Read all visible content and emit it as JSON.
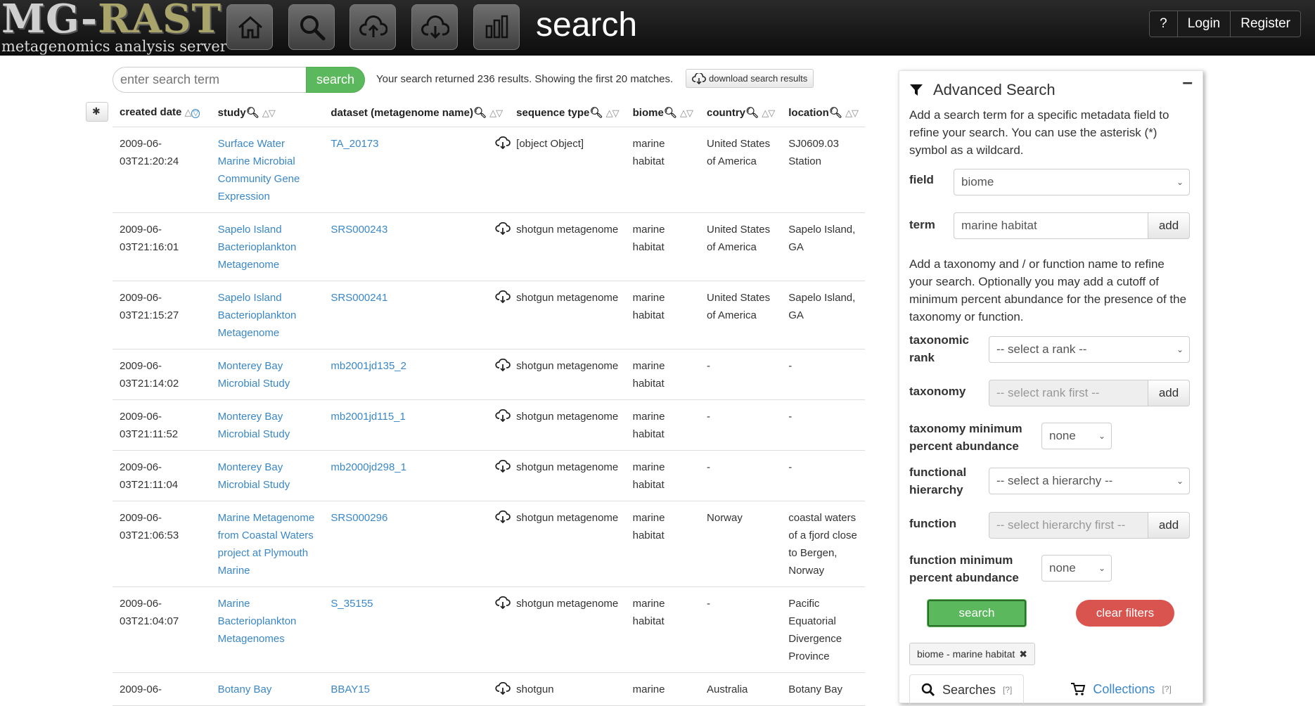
{
  "header": {
    "logo_main": "MG-",
    "logo_accent": "RAST",
    "logo_sub": "metagenomics analysis server",
    "page_title": "search",
    "help": "?",
    "login": "Login",
    "register": "Register",
    "nav_icons": [
      "home-icon",
      "search-icon",
      "upload-icon",
      "download-icon",
      "bar-chart-icon"
    ]
  },
  "search": {
    "placeholder": "enter search term",
    "button": "search",
    "result_text": "Your search returned 236 results. Showing the first 20 matches.",
    "download_label": "download search results"
  },
  "table": {
    "columns": [
      "created date",
      "study",
      "dataset (metagenome name)",
      "sequence type",
      "biome",
      "country",
      "location"
    ],
    "rows": [
      {
        "date": "2009-06-03T21:20:24",
        "study": "Surface Water Marine Microbial Community Gene Expression",
        "dataset": "TA_20173",
        "seq": "[object Object]",
        "biome": "marine habitat",
        "country": "United States of America",
        "location": "SJ0609.03 Station"
      },
      {
        "date": "2009-06-03T21:16:01",
        "study": "Sapelo Island Bacterioplankton Metagenome",
        "dataset": "SRS000243",
        "seq": "shotgun metagenome",
        "biome": "marine habitat",
        "country": "United States of America",
        "location": "Sapelo Island, GA"
      },
      {
        "date": "2009-06-03T21:15:27",
        "study": "Sapelo Island Bacterioplankton Metagenome",
        "dataset": "SRS000241",
        "seq": "shotgun metagenome",
        "biome": "marine habitat",
        "country": "United States of America",
        "location": "Sapelo Island, GA"
      },
      {
        "date": "2009-06-03T21:14:02",
        "study": "Monterey Bay Microbial Study",
        "dataset": "mb2001jd135_2",
        "seq": "shotgun metagenome",
        "biome": "marine habitat",
        "country": "-",
        "location": "-"
      },
      {
        "date": "2009-06-03T21:11:52",
        "study": "Monterey Bay Microbial Study",
        "dataset": "mb2001jd115_1",
        "seq": "shotgun metagenome",
        "biome": "marine habitat",
        "country": "-",
        "location": "-"
      },
      {
        "date": "2009-06-03T21:11:04",
        "study": "Monterey Bay Microbial Study",
        "dataset": "mb2000jd298_1",
        "seq": "shotgun metagenome",
        "biome": "marine habitat",
        "country": "-",
        "location": "-"
      },
      {
        "date": "2009-06-03T21:06:53",
        "study": "Marine Metagenome from Coastal Waters project at Plymouth Marine",
        "dataset": "SRS000296",
        "seq": "shotgun metagenome",
        "biome": "marine habitat",
        "country": "Norway",
        "location": "coastal waters of a fjord close to Bergen, Norway"
      },
      {
        "date": "2009-06-03T21:04:07",
        "study": "Marine Bacterioplankton Metagenomes",
        "dataset": "S_35155",
        "seq": "shotgun metagenome",
        "biome": "marine habitat",
        "country": "-",
        "location": "Pacific Equatorial Divergence Province"
      },
      {
        "date": "2009-06-",
        "study": "Botany Bay",
        "dataset": "BBAY15",
        "seq": "shotgun",
        "biome": "marine",
        "country": "Australia",
        "location": "Botany Bay"
      }
    ]
  },
  "advanced": {
    "title": "Advanced Search",
    "minimize": "–",
    "intro": "Add a search term for a specific metadata field to refine your search. You can use the asterisk (*) symbol as a wildcard.",
    "field_label": "field",
    "field_value": "biome",
    "term_label": "term",
    "term_value": "marine habitat",
    "add": "add",
    "tax_intro": "Add a taxonomy and / or function name to refine your search. Optionally you may add a cutoff of minimum percent abundance for the presence of the taxonomy or function.",
    "rank_label_1": "taxonomic",
    "rank_label_2": "rank",
    "rank_value": "-- select a rank --",
    "taxonomy_label": "taxonomy",
    "taxonomy_placeholder": "-- select rank first --",
    "tax_min_label_1": "taxonomy minimum",
    "tax_min_label_2": "percent abundance",
    "tax_min_value": "none",
    "hier_label_1": "functional",
    "hier_label_2": "hierarchy",
    "hier_value": "-- select a hierarchy --",
    "function_label": "function",
    "function_placeholder": "-- select hierarchy first --",
    "func_min_label_1": "function minimum",
    "func_min_label_2": "percent abundance",
    "func_min_value": "none",
    "search_btn": "search",
    "clear_btn": "clear filters",
    "chip": "biome - marine habitat",
    "tab_searches": "Searches",
    "tab_collections": "Collections",
    "help_mark": "[?]"
  }
}
